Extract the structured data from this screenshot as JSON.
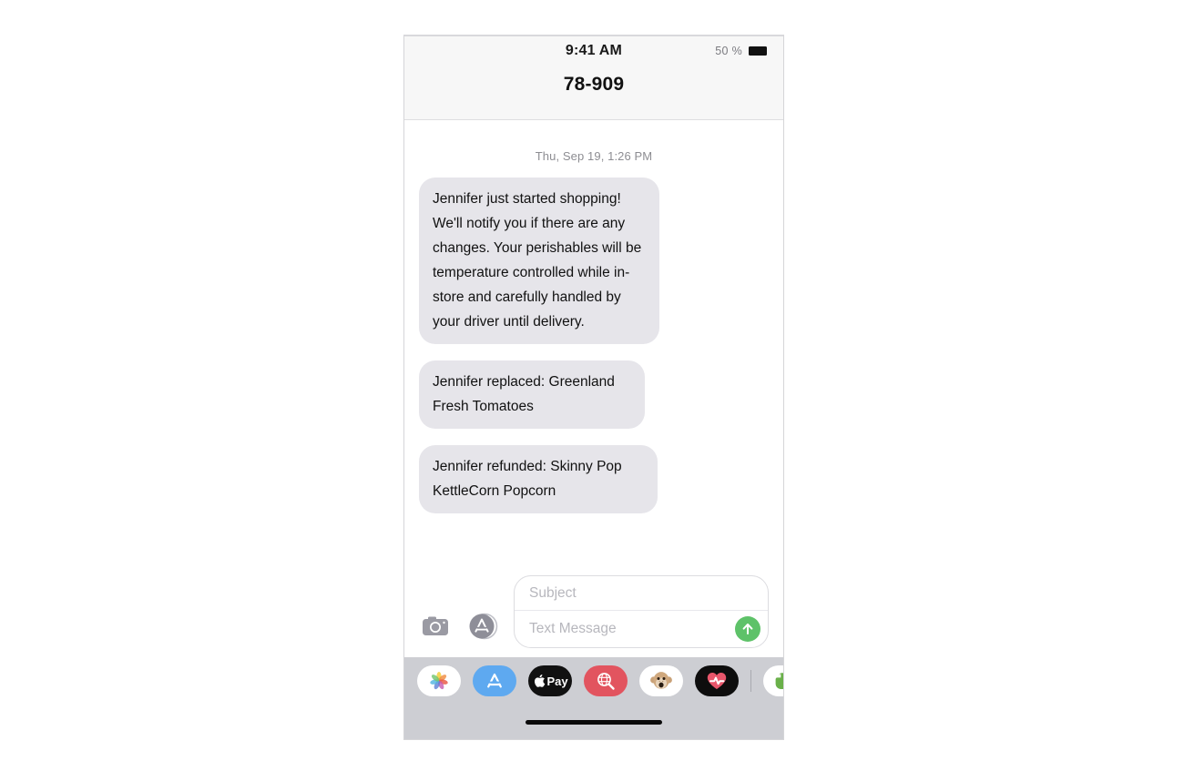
{
  "status_bar": {
    "time": "9:41 AM",
    "battery_percent": "50 %",
    "battery_icon": "battery-full-icon"
  },
  "nav": {
    "title": "78-909"
  },
  "conversation": {
    "timestamp": "Thu, Sep 19, 1:26 PM",
    "messages": [
      {
        "direction": "incoming",
        "text": "Jennifer just started shopping! We'll notify you if there are any changes. Your perishables will be temperature controlled while in-store and carefully handled by your driver until delivery."
      },
      {
        "direction": "incoming",
        "text": "Jennifer replaced: Greenland Fresh Tomatoes"
      },
      {
        "direction": "incoming",
        "text": "Jennifer refunded: Skinny Pop KettleCorn Popcorn"
      }
    ]
  },
  "input_bar": {
    "camera_icon": "camera-icon",
    "appstore_icon": "app-store-icon",
    "subject_placeholder": "Subject",
    "message_placeholder": "Text Message",
    "send_icon": "arrow-up-icon",
    "send_color": "#5ec269"
  },
  "app_drawer": {
    "apps": [
      {
        "name": "photos-app-icon",
        "label": "Photos"
      },
      {
        "name": "app-store-app-icon",
        "label": "App Store"
      },
      {
        "name": "apple-pay-app-icon",
        "label": "Apple Pay"
      },
      {
        "name": "images-search-app-icon",
        "label": "#images"
      },
      {
        "name": "memoji-app-icon",
        "label": "Memoji"
      },
      {
        "name": "digital-touch-app-icon",
        "label": "Digital Touch"
      },
      {
        "name": "evernote-app-icon",
        "label": "Evernote"
      }
    ]
  },
  "colors": {
    "bubble_incoming": "#e6e5ea",
    "drawer_background": "#cdced3",
    "status_background": "#f7f7f7"
  }
}
